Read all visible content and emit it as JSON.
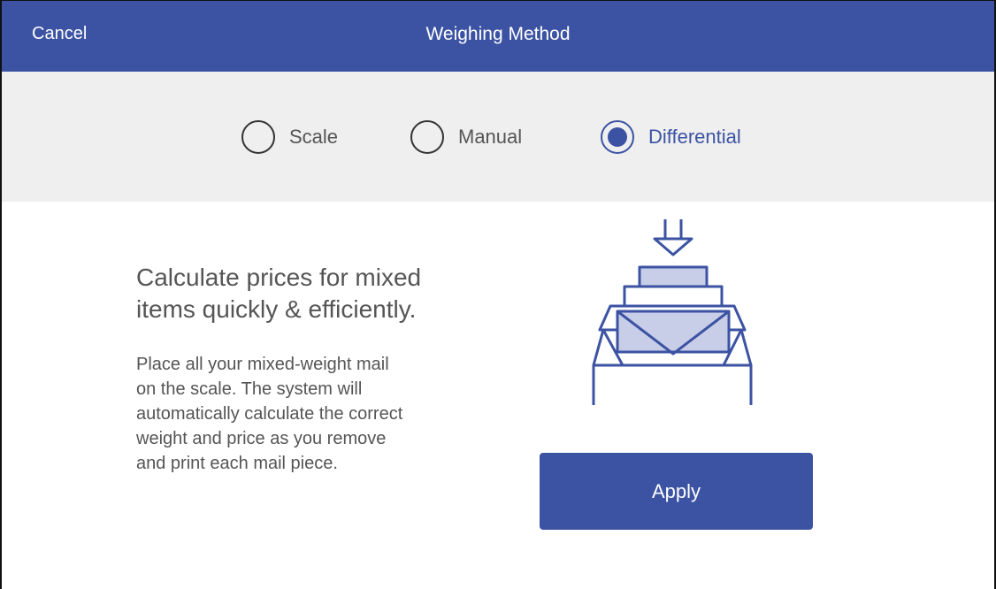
{
  "header": {
    "cancel_label": "Cancel",
    "title": "Weighing Method"
  },
  "weighing_methods": {
    "options": [
      {
        "label": "Scale",
        "selected": false
      },
      {
        "label": "Manual",
        "selected": false
      },
      {
        "label": "Differential",
        "selected": true
      }
    ]
  },
  "content": {
    "headline_line1": "Calculate prices for mixed",
    "headline_line2": "items quickly & efficiently.",
    "description_lines": [
      "Place all your mixed-weight mail",
      "on the scale. The system will",
      "automatically calculate the correct",
      "weight and price as you remove",
      "and print each mail piece."
    ],
    "illustration_icon": "mail-tray-scale-icon",
    "apply_label": "Apply"
  },
  "colors": {
    "brand_blue": "#3c53a3",
    "light_blue_fill": "#c8cde8",
    "bar_gray": "#efefef",
    "text_gray": "#555555"
  }
}
